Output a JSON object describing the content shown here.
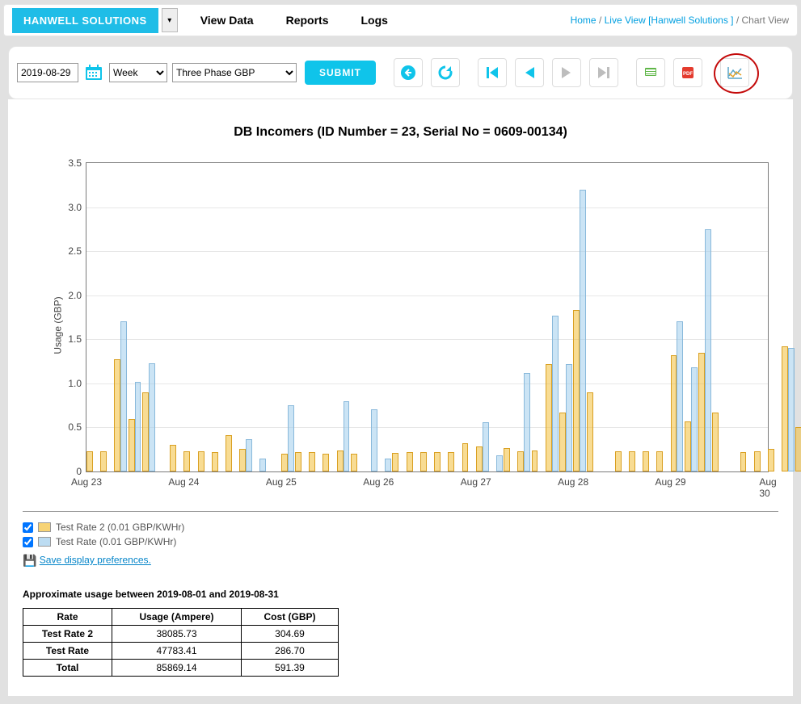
{
  "header": {
    "solutions": "HANWELL SOLUTIONS",
    "nav": {
      "view": "View Data",
      "reports": "Reports",
      "logs": "Logs"
    },
    "bc": {
      "home": "Home",
      "live": "Live View [Hanwell Solutions ]",
      "chart": "Chart View",
      "sep": " / "
    }
  },
  "toolbar": {
    "date": "2019-08-29",
    "interval": "Week",
    "mode": "Three Phase GBP",
    "submit": "SUBMIT"
  },
  "chart_title": "DB Incomers (ID Number = 23, Serial No = 0609-00134)",
  "chart_data": {
    "type": "bar",
    "ylabel": "Usage (GBP)",
    "xlabel": "",
    "ylim": [
      0,
      3.5
    ],
    "yticks": [
      0,
      0.5,
      1.0,
      1.5,
      2.0,
      2.5,
      3.0,
      3.5
    ],
    "xcategories": [
      "Aug 23",
      "Aug 24",
      "Aug 25",
      "Aug 26",
      "Aug 27",
      "Aug 28",
      "Aug 29",
      "Aug 30"
    ],
    "slots_per_day": 7,
    "series": [
      {
        "name": "Test Rate 2 (0.01 GBP/KWHr)",
        "values": [
          0.23,
          0.23,
          1.27,
          0.6,
          0.9,
          0.0,
          0.3,
          0.23,
          0.23,
          0.22,
          0.41,
          0.26,
          0.0,
          0.0,
          0.2,
          0.22,
          0.22,
          0.2,
          0.24,
          0.2,
          0.0,
          0.0,
          0.21,
          0.22,
          0.22,
          0.22,
          0.22,
          0.32,
          0.28,
          0.0,
          0.27,
          0.23,
          0.24,
          1.22,
          0.67,
          1.83,
          0.9,
          0.0,
          0.23,
          0.23,
          0.23,
          0.23,
          1.32,
          0.57,
          1.35,
          0.67,
          0.0,
          0.22,
          0.23,
          0.26,
          1.42,
          0.5
        ]
      },
      {
        "name": "Test Rate (0.01 GBP/KWHr)",
        "values": [
          0.0,
          0.0,
          1.7,
          1.02,
          1.23,
          0.0,
          0.0,
          0.0,
          0.0,
          0.0,
          0.0,
          0.37,
          0.15,
          0.0,
          0.75,
          0.0,
          0.0,
          0.0,
          0.8,
          0.0,
          0.71,
          0.15,
          0.0,
          0.0,
          0.0,
          0.0,
          0.0,
          0.0,
          0.56,
          0.18,
          0.0,
          1.12,
          0.0,
          1.77,
          1.22,
          3.2,
          0.0,
          0.0,
          0.0,
          0.0,
          0.0,
          0.0,
          1.7,
          1.18,
          2.75,
          0.0,
          0.0,
          0.0,
          0.0,
          0.0,
          1.4,
          0.0
        ]
      }
    ]
  },
  "legend": {
    "s1": "Test Rate 2 (0.01 GBP/KWHr)",
    "s2": "Test Rate (0.01 GBP/KWHr)",
    "save": "Save display preferences."
  },
  "usage": {
    "heading": "Approximate usage between 2019-08-01 and 2019-08-31",
    "cols": {
      "rate": "Rate",
      "usage": "Usage (Ampere)",
      "cost": "Cost (GBP)"
    },
    "rows": [
      {
        "rate": "Test Rate 2",
        "usage": "38085.73",
        "cost": "304.69"
      },
      {
        "rate": "Test Rate",
        "usage": "47783.41",
        "cost": "286.70"
      },
      {
        "rate": "Total",
        "usage": "85869.14",
        "cost": "591.39"
      }
    ]
  }
}
